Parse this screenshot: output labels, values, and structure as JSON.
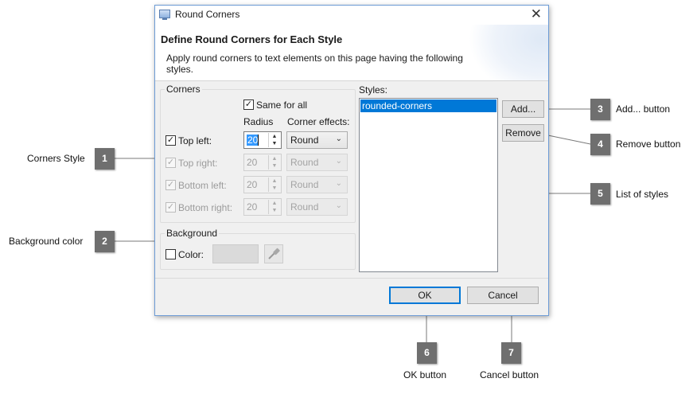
{
  "dialog": {
    "title": "Round Corners",
    "heading": "Define Round Corners for Each Style",
    "description": "Apply round corners to text elements on this page having the following styles.",
    "close_glyph": "✕"
  },
  "corners": {
    "legend": "Corners",
    "same_for_all": {
      "label": "Same for all",
      "checked": true
    },
    "col_radius": "Radius",
    "col_effects": "Corner effects:",
    "rows": [
      {
        "label": "Top left:",
        "checked": true,
        "enabled": true,
        "radius": "20",
        "effect": "Round"
      },
      {
        "label": "Top right:",
        "checked": true,
        "enabled": false,
        "radius": "20",
        "effect": "Round"
      },
      {
        "label": "Bottom left:",
        "checked": true,
        "enabled": false,
        "radius": "20",
        "effect": "Round"
      },
      {
        "label": "Bottom right:",
        "checked": true,
        "enabled": false,
        "radius": "20",
        "effect": "Round"
      }
    ]
  },
  "background": {
    "legend": "Background",
    "color_label": "Color:",
    "color_checked": false
  },
  "styles": {
    "label": "Styles:",
    "items": [
      "rounded-corners"
    ],
    "selected_index": 0
  },
  "buttons": {
    "add": "Add...",
    "remove": "Remove",
    "ok": "OK",
    "cancel": "Cancel"
  },
  "callouts": [
    {
      "number": "1",
      "text": "Corners Style"
    },
    {
      "number": "2",
      "text": "Background color"
    },
    {
      "number": "3",
      "text": "Add... button"
    },
    {
      "number": "4",
      "text": "Remove button"
    },
    {
      "number": "5",
      "text": "List of styles"
    },
    {
      "number": "6",
      "text": "OK button"
    },
    {
      "number": "7",
      "text": "Cancel button"
    }
  ],
  "colors": {
    "selection": "#0078d7",
    "marker": "#6f6f6f",
    "dialog_bg": "#f0f0f0"
  }
}
